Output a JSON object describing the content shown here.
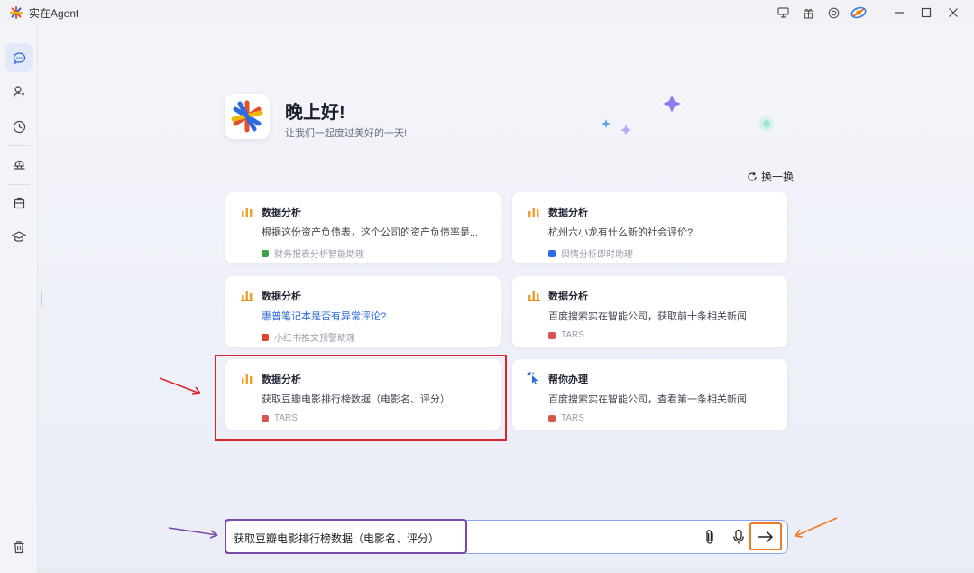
{
  "window": {
    "title": "实在Agent"
  },
  "hero": {
    "greeting": "晚上好!",
    "subtitle": "让我们一起度过美好的一天!"
  },
  "refresh_label": "换一换",
  "cards": [
    {
      "category": "数据分析",
      "text": "根据这份资产负债表，这个公司的资产负债率是...",
      "source": "财务报表分析智能助理",
      "source_color": "#3da34a",
      "icon": "bar-chart-icon"
    },
    {
      "category": "数据分析",
      "text": "杭州六小龙有什么新的社会评价?",
      "source": "舆情分析即时助理",
      "source_color": "#2f6be0",
      "icon": "bar-chart-icon"
    },
    {
      "category": "数据分析",
      "text": "惠普笔记本是否有异常评论?",
      "source": "小红书推文预警助理",
      "source_color": "#e0442c",
      "icon": "bar-chart-icon",
      "text_is_link": true
    },
    {
      "category": "数据分析",
      "text": "百度搜索实在智能公司，获取前十条相关新闻",
      "source": "TARS",
      "source_color": "#d9534f",
      "icon": "bar-chart-icon"
    },
    {
      "category": "数据分析",
      "text": "获取豆瓣电影排行榜数据（电影名、评分）",
      "source": "TARS",
      "source_color": "#d9534f",
      "icon": "bar-chart-icon"
    },
    {
      "category": "帮你办理",
      "text": "百度搜索实在智能公司，查看第一条相关新闻",
      "source": "TARS",
      "source_color": "#d9534f",
      "icon": "cursor-click-icon"
    }
  ],
  "input": {
    "value": "获取豆瓣电影排行榜数据（电影名、评分）"
  },
  "colors": {
    "accent": "#2f6be0",
    "annotation_red": "#d8262c",
    "annotation_purple": "#7a4aa8",
    "annotation_orange": "#ee7a26",
    "chart_icon_orange": "#f0a030"
  }
}
